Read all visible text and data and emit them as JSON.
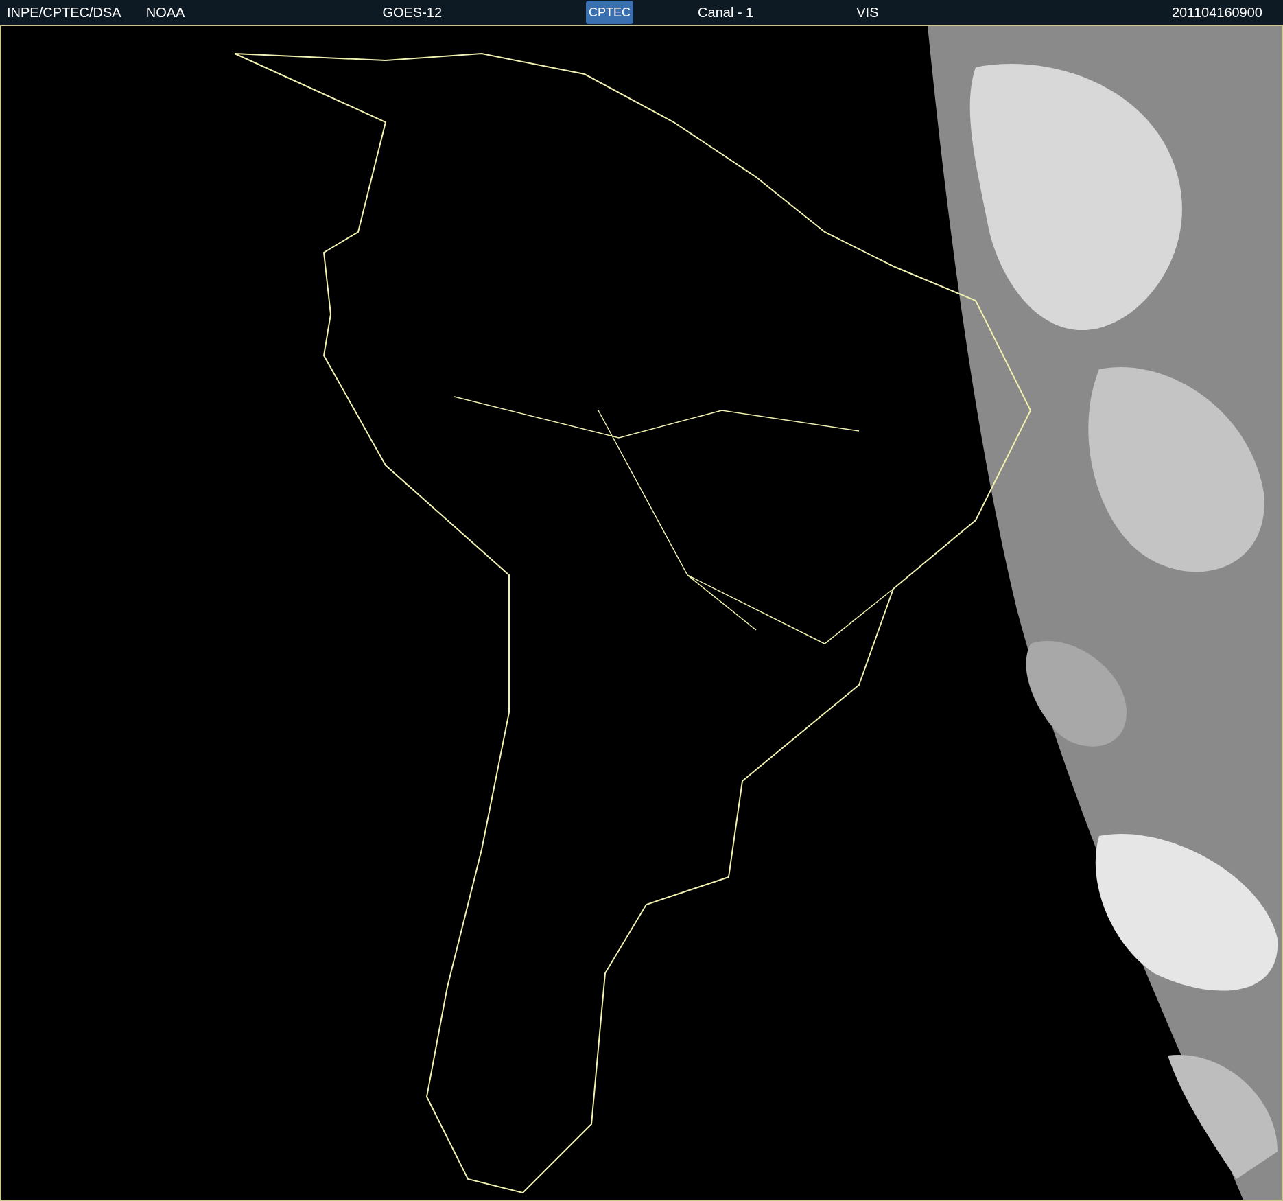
{
  "header": {
    "agency": "INPE/CPTEC/DSA",
    "provider": "NOAA",
    "satellite": "GOES-12",
    "logo": "CPTEC",
    "channel": "Canal - 1",
    "band": "VIS",
    "timestamp": "201104160900"
  }
}
